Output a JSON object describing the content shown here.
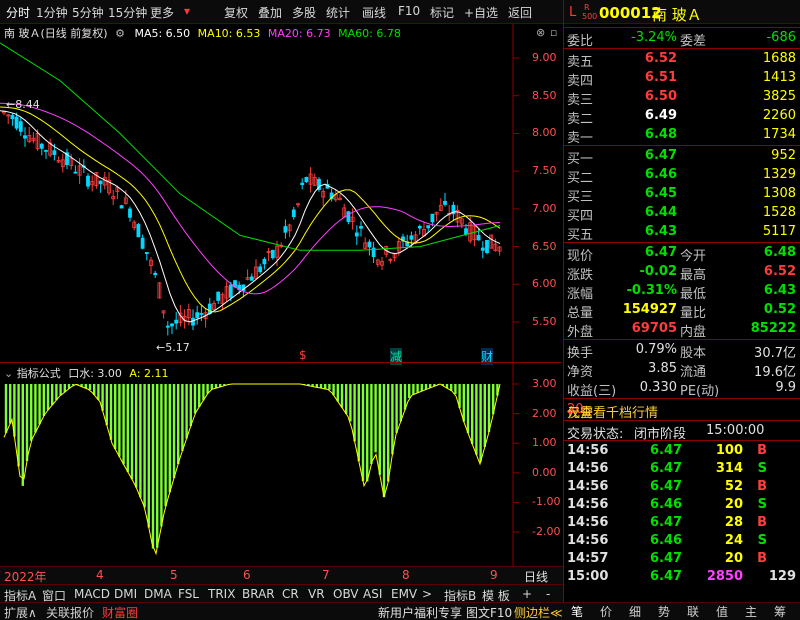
{
  "toolbar": {
    "items": [
      "分时",
      "1分钟",
      "5分钟",
      "15分钟",
      "更多",
      "复权",
      "叠加",
      "多股",
      "统计",
      "画线",
      "F10",
      "标记",
      "+自选",
      "返回"
    ]
  },
  "stock": {
    "code_prefix": "L",
    "badge_r": "R",
    "badge_500": "500",
    "code": "000012",
    "name": "南 玻Ａ"
  },
  "main_chart": {
    "title": "南 玻Ａ(日线 前复权)",
    "ma_labels": [
      {
        "text": "MA5: 6.50",
        "color": "#ffffff"
      },
      {
        "text": "MA10: 6.53",
        "color": "#ffff00"
      },
      {
        "text": "MA20: 6.73",
        "color": "#ff40ff"
      },
      {
        "text": "MA60: 6.78",
        "color": "#00e000"
      }
    ],
    "y_ticks": [
      "9.00",
      "8.50",
      "8.00",
      "7.50",
      "7.00",
      "6.50",
      "6.00",
      "5.50"
    ],
    "y_tick_values": [
      9.0,
      8.5,
      8.0,
      7.5,
      7.0,
      6.5,
      6.0,
      5.5
    ],
    "high_label": "8.44",
    "low_label": "5.17",
    "markers": [
      {
        "text": "$",
        "color": "#ff3c3c"
      },
      {
        "text": "减",
        "color": "#00e0a0"
      },
      {
        "text": "财",
        "color": "#00d8ff"
      }
    ]
  },
  "indicator": {
    "title": "指标公式",
    "params": [
      {
        "text": "口水: 3.00",
        "color": "#e0e0e0"
      },
      {
        "text": "A: 2.11",
        "color": "#ffff00"
      }
    ],
    "y_ticks": [
      "3.00",
      "2.00",
      "1.00",
      "0.00",
      "-1.00",
      "-2.00"
    ],
    "y_tick_values": [
      3,
      2,
      1,
      0,
      -1,
      -2
    ]
  },
  "time_axis": {
    "labels": [
      "2022年",
      "4",
      "5",
      "6",
      "7",
      "8",
      "9"
    ],
    "period": "日线"
  },
  "tabs": [
    "指标A",
    "窗口",
    "MACD",
    "DMI",
    "DMA",
    "FSL",
    "TRIX",
    "BRAR",
    "CR",
    "VR",
    "OBV",
    "ASI",
    "EMV",
    ">",
    "指标B",
    "模 板",
    "+",
    "-"
  ],
  "order_book": {
    "weibi_label": "委比",
    "weibi_value": "-3.24%",
    "weicha_label": "委差",
    "weicha_value": "-686",
    "asks": [
      {
        "label": "卖五",
        "price": "6.52",
        "vol": "1688",
        "pcolor": "#ff3c3c"
      },
      {
        "label": "卖四",
        "price": "6.51",
        "vol": "1413",
        "pcolor": "#ff3c3c"
      },
      {
        "label": "卖三",
        "price": "6.50",
        "vol": "3825",
        "pcolor": "#ff3c3c"
      },
      {
        "label": "卖二",
        "price": "6.49",
        "vol": "2260",
        "pcolor": "#ffffff"
      },
      {
        "label": "卖一",
        "price": "6.48",
        "vol": "1734",
        "pcolor": "#00e000"
      }
    ],
    "bids": [
      {
        "label": "买一",
        "price": "6.47",
        "vol": "952",
        "pcolor": "#00e000"
      },
      {
        "label": "买二",
        "price": "6.46",
        "vol": "1329",
        "pcolor": "#00e000"
      },
      {
        "label": "买三",
        "price": "6.45",
        "vol": "1308",
        "pcolor": "#00e000"
      },
      {
        "label": "买四",
        "price": "6.44",
        "vol": "1528",
        "pcolor": "#00e000"
      },
      {
        "label": "买五",
        "price": "6.43",
        "vol": "5117",
        "pcolor": "#00e000"
      }
    ]
  },
  "quote": [
    {
      "l1": "现价",
      "v1": "6.47",
      "c1": "#00e000",
      "l2": "今开",
      "v2": "6.48",
      "c2": "#00e000"
    },
    {
      "l1": "涨跌",
      "v1": "-0.02",
      "c1": "#00e000",
      "l2": "最高",
      "v2": "6.52",
      "c2": "#ff3c3c"
    },
    {
      "l1": "涨幅",
      "v1": "-0.31%",
      "c1": "#00e000",
      "l2": "最低",
      "v2": "6.43",
      "c2": "#00e000"
    },
    {
      "l1": "总量",
      "v1": "154927",
      "c1": "#ffff00",
      "l2": "量比",
      "v2": "0.52",
      "c2": "#00e000"
    },
    {
      "l1": "外盘",
      "v1": "69705",
      "c1": "#ff3c3c",
      "l2": "内盘",
      "v2": "85222",
      "c2": "#00e000"
    }
  ],
  "finance": [
    {
      "l1": "换手",
      "v1": "0.79%",
      "l2": "股本",
      "v2": "30.7亿"
    },
    {
      "l1": "净资",
      "v1": "3.85",
      "l2": "流通",
      "v2": "19.6亿"
    },
    {
      "l1": "收益(三)",
      "v1": "0.330",
      "l2": "PE(动)",
      "v2": "9.9"
    }
  ],
  "promo": {
    "prefix": "仅需",
    "amount": "20",
    "suffix": "元查看千档行情"
  },
  "trade_status": {
    "label": "交易状态:",
    "value": "闭市阶段",
    "time": "15:00:00"
  },
  "ticks": [
    {
      "time": "14:56",
      "price": "6.47",
      "vol": "100",
      "side": "B",
      "vcolor": "#ffff00"
    },
    {
      "time": "14:56",
      "price": "6.47",
      "vol": "314",
      "side": "S",
      "vcolor": "#ffff00"
    },
    {
      "time": "14:56",
      "price": "6.47",
      "vol": "52",
      "side": "B",
      "vcolor": "#ffff00"
    },
    {
      "time": "14:56",
      "price": "6.46",
      "vol": "20",
      "side": "S",
      "vcolor": "#ffff00"
    },
    {
      "time": "14:56",
      "price": "6.47",
      "vol": "28",
      "side": "B",
      "vcolor": "#ffff00"
    },
    {
      "time": "14:56",
      "price": "6.46",
      "vol": "24",
      "side": "S",
      "vcolor": "#ffff00"
    },
    {
      "time": "14:57",
      "price": "6.47",
      "vol": "20",
      "side": "B",
      "vcolor": "#ffff00"
    },
    {
      "time": "15:00",
      "price": "6.47",
      "vol": "2850",
      "side": "129",
      "vcolor": "#ff40ff"
    }
  ],
  "bottom_bar": {
    "left": [
      "扩展∧",
      "关联报价",
      "财富圈"
    ],
    "right": [
      "新用户福利专享",
      "图文F10",
      "侧边栏≪"
    ],
    "side_icons": [
      "笔",
      "价",
      "细",
      "势",
      "联",
      "值",
      "主",
      "筹"
    ]
  },
  "colors": {
    "up": "#ff3c3c",
    "down": "#00e000",
    "ma5": "#ffffff",
    "ma10": "#ffff00",
    "ma20": "#ff40ff",
    "ma60": "#00e000",
    "indicator_bar": "#7cff30",
    "frame": "#8b0000"
  }
}
